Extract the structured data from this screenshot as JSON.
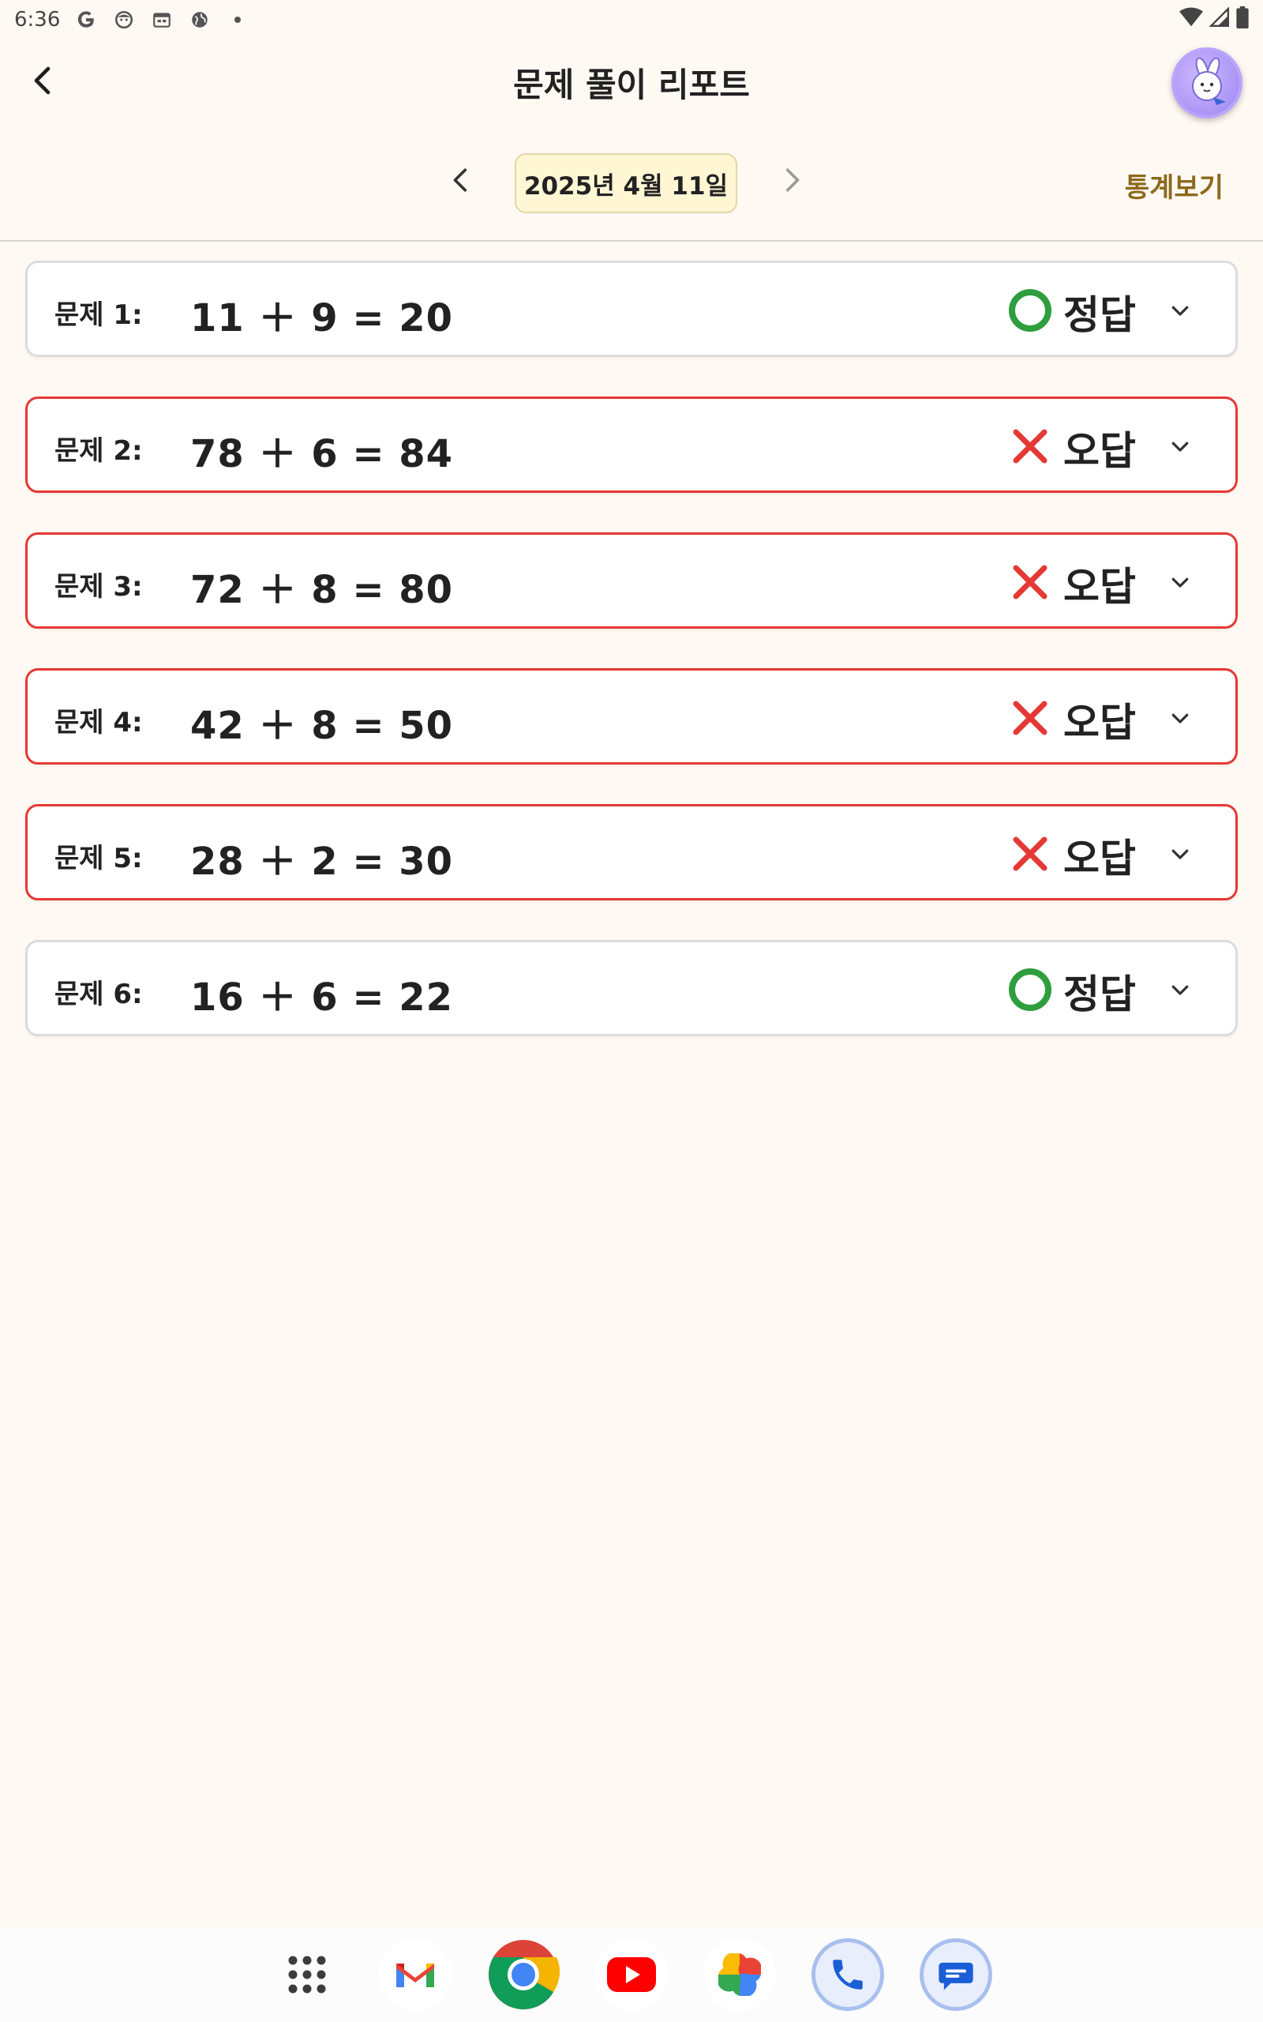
{
  "status_bar": {
    "time": "6:36",
    "icons": [
      "google-g-icon",
      "face-icon",
      "calendar-icon",
      "globe-icon",
      "dot-icon"
    ],
    "right_icons": [
      "wifi-icon",
      "signal-icon",
      "battery-icon"
    ]
  },
  "app_bar": {
    "title": "문제 풀이 리포트",
    "back_icon": "chevron-left-icon",
    "avatar_icon": "bunny-avatar"
  },
  "date_nav": {
    "date_label": "2025년 4월 11일",
    "stats_label": "통계보기"
  },
  "problems": [
    {
      "label": "문제 1:",
      "equation": "11 ＋ 9 = 20",
      "result": "정답",
      "correct": true
    },
    {
      "label": "문제 2:",
      "equation": "78 ＋ 6 = 84",
      "result": "오답",
      "correct": false
    },
    {
      "label": "문제 3:",
      "equation": "72 ＋ 8 = 80",
      "result": "오답",
      "correct": false
    },
    {
      "label": "문제 4:",
      "equation": "42 ＋ 8 = 50",
      "result": "오답",
      "correct": false
    },
    {
      "label": "문제 5:",
      "equation": "28 ＋ 2 = 30",
      "result": "오답",
      "correct": false
    },
    {
      "label": "문제 6:",
      "equation": "16 ＋ 6 = 22",
      "result": "정답",
      "correct": true
    }
  ],
  "colors": {
    "background": "#fff9f3",
    "correct": "#2e9e3e",
    "wrong": "#e53935",
    "stats_link": "#8b6a1c",
    "date_chip": "#fff6d4"
  },
  "dock": {
    "apps": [
      "app-drawer-icon",
      "gmail-icon",
      "chrome-icon",
      "youtube-icon",
      "photos-icon",
      "phone-icon",
      "messages-icon"
    ]
  }
}
